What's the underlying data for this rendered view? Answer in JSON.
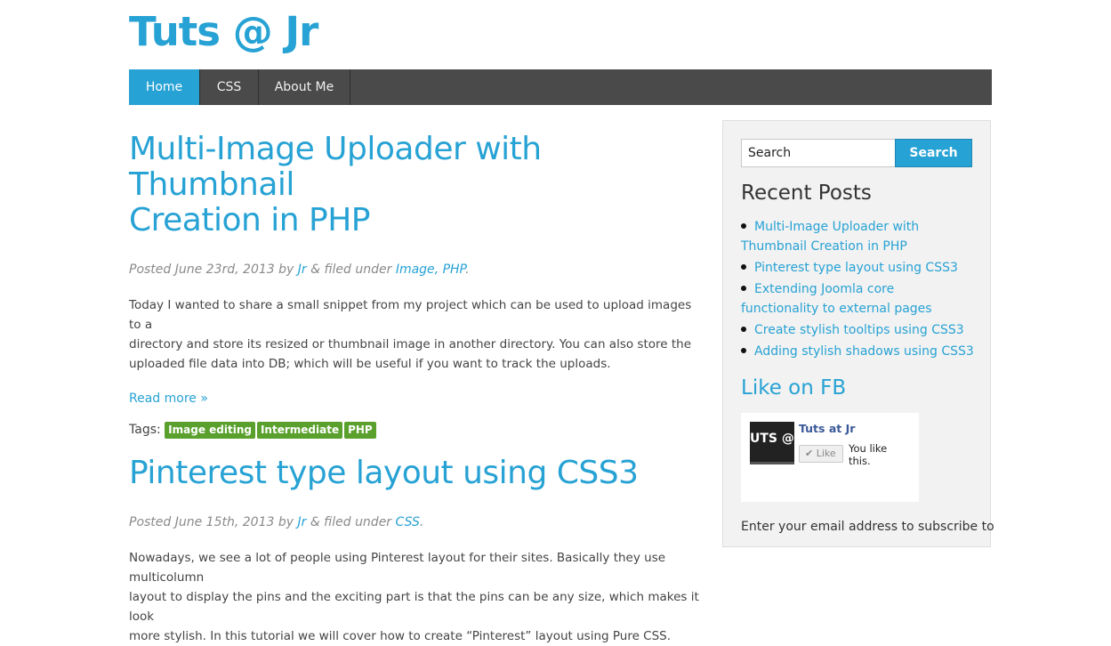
{
  "site": {
    "title": "Tuts @ Jr"
  },
  "nav": {
    "items": [
      "Home",
      "CSS",
      "About Me"
    ]
  },
  "posts": [
    {
      "title_line1": "Multi-Image Uploader with Thumbnail",
      "title_line2": "Creation in PHP",
      "posted_prefix": "Posted June 23rd, 2013 by",
      "author": "Jr",
      "filed_text": "& filed under",
      "categories": [
        "Image",
        "PHP"
      ],
      "excerpt_line1": "Today I wanted to share a small snippet from my project which can be used to upload images to a",
      "excerpt_line2": "directory and store its resized or thumbnail image in another directory. You can also store the",
      "excerpt_line3": "uploaded file data into DB; which will be useful if you want to track the uploads.",
      "read_more": "Read more »",
      "tags_label": "Tags:",
      "tags": [
        "Image editing",
        "Intermediate",
        "PHP"
      ]
    },
    {
      "title_line1": "Pinterest type layout using CSS3",
      "posted_prefix": "Posted June 15th, 2013 by",
      "author": "Jr",
      "filed_text": "& filed under",
      "categories": [
        "CSS"
      ],
      "excerpt_line1": "Nowadays, we see a lot of people using Pinterest layout for their sites. Basically they use multicolumn",
      "excerpt_line2": "layout to display the pins and the exciting part is that the pins can be any size, which makes it look",
      "excerpt_line3": "more stylish. In this tutorial we will cover how to create “Pinterest” layout using Pure CSS."
    }
  ],
  "sidebar": {
    "search_placeholder": "Search",
    "search_button": "Search",
    "recent_title": "Recent Posts",
    "recent_posts": [
      "Multi-Image Uploader with Thumbnail Creation in PHP",
      "Pinterest type layout using CSS3",
      "Extending Joomla core functionality to external pages",
      "Create stylish tooltips using CSS3",
      "Adding stylish shadows using CSS3"
    ],
    "fb_title": "Like on FB",
    "fb_thumb_text": "UTS @ J",
    "fb_page_name": "Tuts at Jr",
    "fb_like_label": "✔ Like",
    "fb_you_like": "You like this.",
    "subscribe_text": "Enter your email address to subscribe to"
  },
  "colors": {
    "accent": "#27a2d4",
    "nav_bg": "#4a4a4a",
    "tag_bg": "#5aa02c"
  }
}
